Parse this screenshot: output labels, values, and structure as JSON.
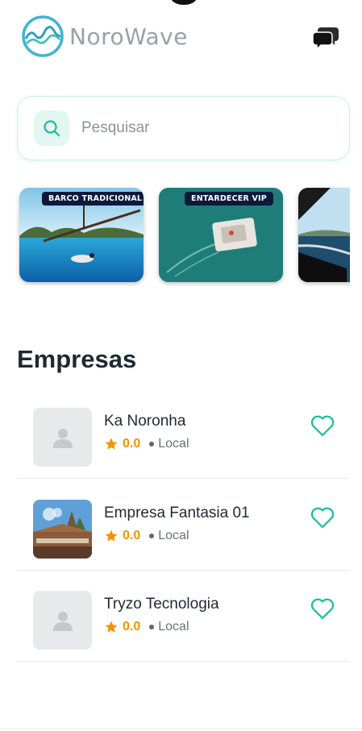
{
  "app": {
    "name": "NoroWave"
  },
  "header": {
    "chat_icon": "chat-bubbles-icon"
  },
  "search": {
    "placeholder": "Pesquisar",
    "value": "",
    "icon": "search-icon"
  },
  "banners": [
    {
      "label": "BARCO TRADICIONAL"
    },
    {
      "label": "ENTARDECER VIP"
    },
    {
      "label": ""
    }
  ],
  "section": {
    "title": "Empresas"
  },
  "companies": [
    {
      "name": "Ka Noronha",
      "rating": "0.0",
      "location": "Local",
      "has_photo": false
    },
    {
      "name": "Empresa Fantasia 01",
      "rating": "0.0",
      "location": "Local",
      "has_photo": true
    },
    {
      "name": "Tryzo Tecnologia",
      "rating": "0.0",
      "location": "Local",
      "has_photo": false
    }
  ],
  "colors": {
    "accent": "#1abc9c",
    "star": "#f39200",
    "text": "#1f2933",
    "muted": "#6b7178"
  }
}
